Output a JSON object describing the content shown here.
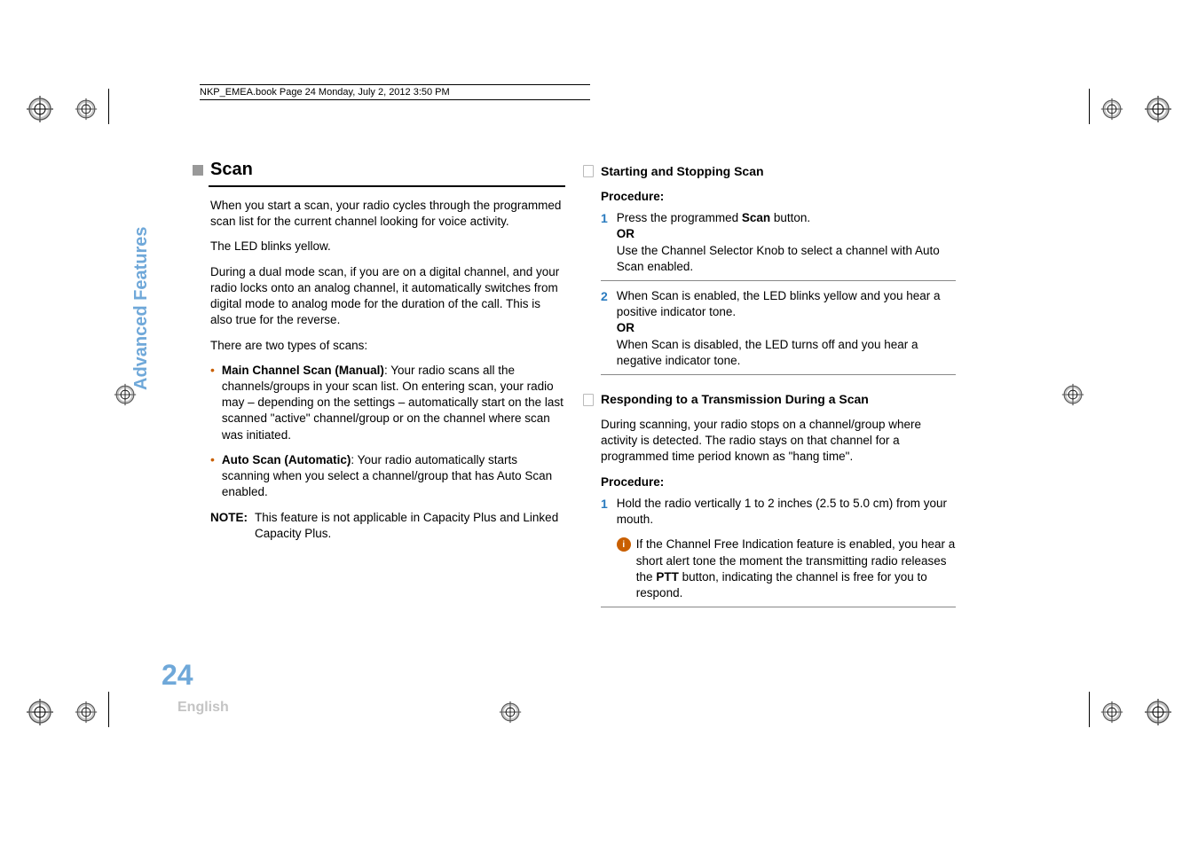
{
  "header": "NKP_EMEA.book  Page 24  Monday, July 2, 2012  3:50 PM",
  "side_label": "Advanced Features",
  "page_number": "24",
  "language": "English",
  "left": {
    "title": "Scan",
    "p1": "When you start a scan, your radio cycles through the programmed scan list for the current channel looking for voice activity.",
    "p2": "The LED blinks yellow.",
    "p3": "During a dual mode scan, if you are on a digital channel, and your radio locks onto an analog channel, it automatically switches from digital mode to analog mode for the duration of the call. This is also true for the reverse.",
    "p4": "There are two types of scans:",
    "bullet1_bold": "Main Channel Scan (Manual)",
    "bullet1_rest": ": Your radio scans all the channels/groups in your scan list. On entering scan, your radio may – depending on the settings – automatically start on the last scanned \"active\" channel/group or on the channel where scan was initiated.",
    "bullet2_bold": "Auto Scan (Automatic)",
    "bullet2_rest": ": Your radio automatically starts scanning when you select a channel/group that has Auto Scan enabled.",
    "note_label": "NOTE:",
    "note_text": "This feature is not applicable in Capacity Plus and Linked Capacity Plus."
  },
  "right": {
    "h1": "Starting and Stopping Scan",
    "proc1_label": "Procedure",
    "proc1_colon": ":",
    "step1_a": "Press the programmed ",
    "step1_scan": "Scan",
    "step1_b": " button.",
    "or": "OR",
    "step1_c": "Use the Channel Selector Knob to select a channel with Auto Scan enabled.",
    "step2_a": "When Scan is enabled, the LED blinks yellow and you hear a positive indicator tone.",
    "step2_b": "When Scan is disabled, the LED turns off and you hear a negative indicator tone.",
    "h2": "Responding to a Transmission During a Scan",
    "p_resp": "During scanning, your radio stops on a channel/group where activity is detected. The radio stays on that channel for a programmed time period known as \"hang time\".",
    "proc2_label": "Procedure:",
    "resp_step1": "Hold the radio vertically 1 to 2 inches (2.5 to 5.0 cm) from your mouth.",
    "info_a": "If the Channel Free Indication feature is enabled, you hear a short alert tone the moment the transmitting radio releases the ",
    "ptt": "PTT",
    "info_b": " button, indicating the channel is free for you to respond.",
    "info_icon": "i"
  },
  "nums": {
    "one": "1",
    "two": "2"
  }
}
